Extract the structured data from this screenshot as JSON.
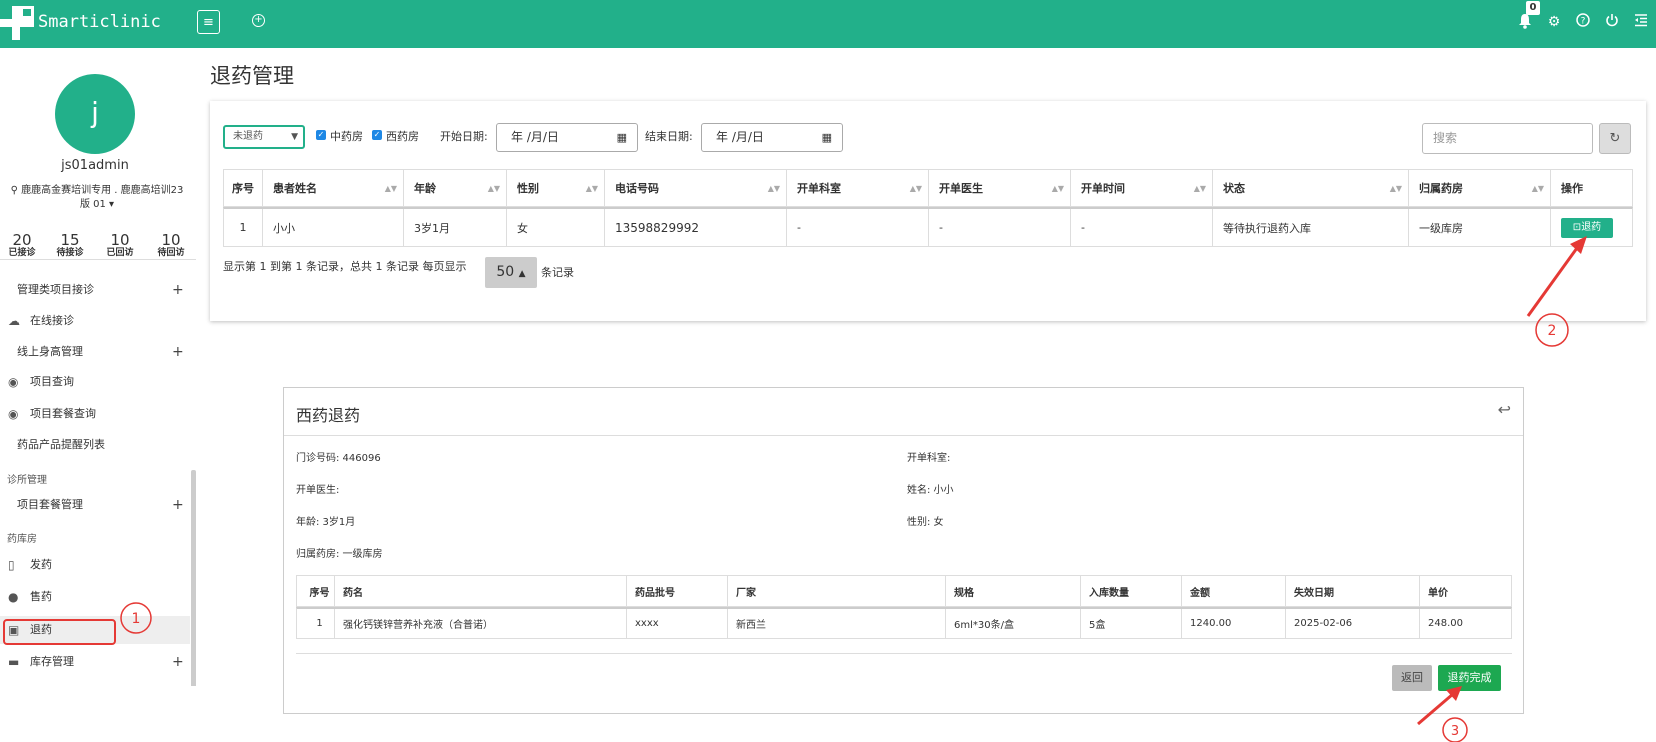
{
  "app": {
    "brand": "Smarticlinic",
    "notification_count": "0"
  },
  "sidebar": {
    "avatar_letter": "j",
    "username": "js01admin",
    "org": "鹿鹿高金赛培训专用 . 鹿鹿高培训23版 01",
    "stats": [
      {
        "num": "20",
        "label": "已接诊"
      },
      {
        "num": "15",
        "label": "待接诊"
      },
      {
        "num": "10",
        "label": "已回访"
      },
      {
        "num": "10",
        "label": "待回访"
      }
    ],
    "items": [
      {
        "label": "管理类项目接诊",
        "icon": "",
        "has_plus": true
      },
      {
        "label": "在线接诊",
        "icon": "cloud-icon",
        "has_plus": false
      },
      {
        "label": "线上身高管理",
        "icon": "",
        "has_plus": true
      },
      {
        "label": "项目查询",
        "icon": "eye-slash-icon",
        "has_plus": false
      },
      {
        "label": "项目套餐查询",
        "icon": "eye-slash-icon",
        "has_plus": false
      },
      {
        "label": "药品产品提醒列表",
        "icon": "",
        "has_plus": false
      },
      {
        "label": "诊所管理",
        "section": true
      },
      {
        "label": "项目套餐管理",
        "icon": "",
        "has_plus": true
      },
      {
        "label": "药库房",
        "section": true
      },
      {
        "label": "发药",
        "icon": "bottle-icon",
        "has_plus": false
      },
      {
        "label": "售药",
        "icon": "pills-icon",
        "has_plus": false
      },
      {
        "label": "退药",
        "icon": "return-drug-icon",
        "has_plus": false,
        "active": true
      },
      {
        "label": "库存管理",
        "icon": "truck-icon",
        "has_plus": true
      }
    ]
  },
  "page": {
    "title": "退药管理"
  },
  "filters": {
    "status_select": "未退药",
    "chinese_pharmacy": "中药房",
    "western_pharmacy": "西药房",
    "start_label": "开始日期:",
    "end_label": "结束日期:",
    "date_placeholder": "年 /月/日",
    "search_placeholder": "搜索"
  },
  "table": {
    "headers": [
      "序号",
      "患者姓名",
      "年龄",
      "性别",
      "电话号码",
      "开单科室",
      "开单医生",
      "开单时间",
      "状态",
      "归属药房",
      "操作"
    ],
    "rows": [
      [
        "1",
        "小小",
        "3岁1月",
        "女",
        "13598829992",
        "-",
        "-",
        "-",
        "等待执行退药入库",
        "一级库房"
      ]
    ],
    "action_label": "退药"
  },
  "pager": {
    "summary": "显示第 1 到第 1 条记录，总共 1 条记录  每页显示",
    "page_size": "50",
    "suffix": "条记录"
  },
  "modal": {
    "title": "西药退药",
    "clinic_no": "门诊号码: 446096",
    "dept": "开单科室:",
    "doctor": "开单医生:",
    "name": "姓名: 小小",
    "age": "年龄: 3岁1月",
    "gender": "性别: 女",
    "pharmacy": "归属药房: 一级库房",
    "headers": [
      "序号",
      "药名",
      "药品批号",
      "厂家",
      "规格",
      "入库数量",
      "金额",
      "失效日期",
      "单价"
    ],
    "rows": [
      [
        "1",
        "强化钙镁锌营养补充液（合普诺）",
        "xxxx",
        "新西兰",
        "6ml*30条/盒",
        "5盒",
        "1240.00",
        "2025-02-06",
        "248.00"
      ]
    ],
    "back_button": "返回",
    "done_button": "退药完成"
  },
  "annotations": [
    "1",
    "2",
    "3"
  ],
  "colors": {
    "accent": "#22b08a",
    "done": "#1da851",
    "annotation": "#e53935"
  }
}
